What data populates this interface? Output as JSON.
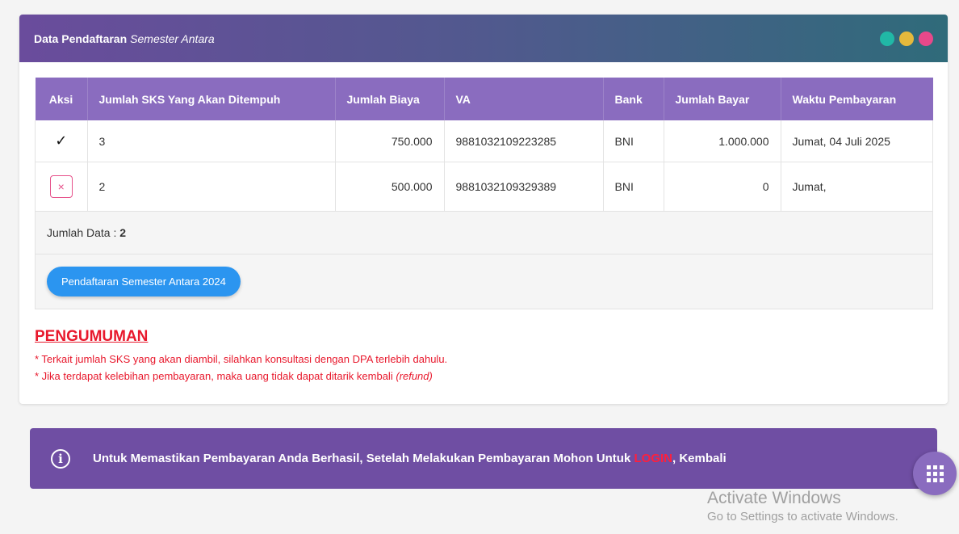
{
  "panel": {
    "title": "Data Pendaftaran",
    "subtitle": "Semester Antara",
    "dot_colors": [
      "#21b8a6",
      "#e6b93c",
      "#e8488a"
    ]
  },
  "table": {
    "headers": [
      "Aksi",
      "Jumlah SKS Yang Akan Ditempuh",
      "Jumlah Biaya",
      "VA",
      "Bank",
      "Jumlah Bayar",
      "Waktu Pembayaran"
    ],
    "rows": [
      {
        "action_icon": "check-icon",
        "action_symbol": "✓",
        "sks": "3",
        "biaya": "750.000",
        "va": "9881032109223285",
        "bank": "BNI",
        "bayar": "1.000.000",
        "waktu": "Jumat, 04 Juli 2025"
      },
      {
        "action_icon": "close-icon",
        "action_symbol": "×",
        "sks": "2",
        "biaya": "500.000",
        "va": "9881032109329389",
        "bank": "BNI",
        "bayar": "0",
        "waktu": "Jumat,"
      }
    ],
    "count_label": "Jumlah Data : ",
    "count_value": "2"
  },
  "register_button": "Pendaftaran Semester Antara 2024",
  "announcement": {
    "title": "PENGUMUMAN",
    "line1": "* Terkait jumlah SKS yang akan diambil, silahkan konsultasi dengan DPA terlebih dahulu.",
    "line2_prefix": "* Jika terdapat kelebihan pembayaran, maka uang tidak dapat ditarik kembali ",
    "line2_italic": "(refund)"
  },
  "info_bar": {
    "icon": "info-icon",
    "icon_glyph": "i",
    "text_before": "Untuk Memastikan Pembayaran Anda Berhasil, Setelah Melakukan Pembayaran Mohon Untuk ",
    "login": "LOGIN",
    "text_after": ", Kembali"
  },
  "fab_icon": "grid-menu-icon",
  "watermark": {
    "line1": "Activate Windows",
    "line2": "Go to Settings to activate Windows."
  }
}
